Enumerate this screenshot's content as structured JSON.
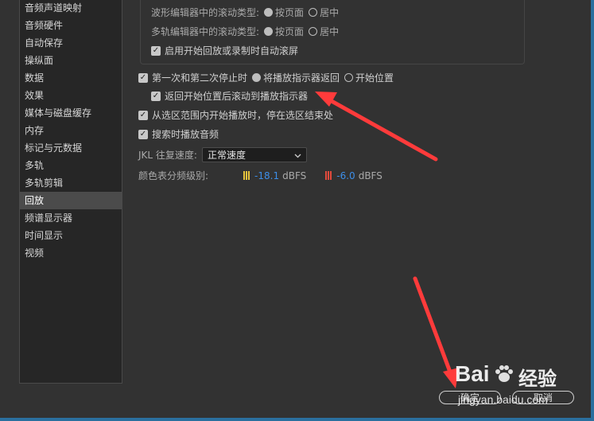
{
  "sidebar": {
    "items": [
      "音频声道映射",
      "音频硬件",
      "自动保存",
      "操纵面",
      "数据",
      "效果",
      "媒体与磁盘缓存",
      "内存",
      "标记与元数据",
      "多轨",
      "多轨剪辑",
      "回放",
      "频谱显示器",
      "时间显示",
      "视频"
    ],
    "active_index": 11
  },
  "group": {
    "wave_label": "波形编辑器中的滚动类型:",
    "multi_label": "多轨编辑器中的滚动类型:",
    "opt_page": "按页面",
    "opt_center": "居中",
    "auto_scroll": "启用开始回放或录制时自动滚屏"
  },
  "options": {
    "first_second_stop": "第一次和第二次停止时",
    "return_indicator": "将播放指示器返回",
    "start_position": "开始位置",
    "scroll_after_return": "返回开始位置后滚动到播放指示器",
    "stop_at_selection": "从选区范围内开始播放时，停在选区结束处",
    "scrub_audio": "搜索时播放音频"
  },
  "jkl": {
    "label": "JKL 往复速度:",
    "value": "正常速度"
  },
  "color_levels": {
    "label": "颜色表分频级别:",
    "yellow_value": "-18.1",
    "red_value": "-6.0",
    "unit": "dBFS",
    "colors": {
      "yellow": "#e8c33c",
      "red": "#e24a3c"
    }
  },
  "buttons": {
    "ok": "确定",
    "cancel": "取消"
  },
  "watermark": {
    "brand": "Bai",
    "brand2": "经验",
    "url": "jingyan.baidu.com"
  },
  "accent": "#ff3b3b"
}
